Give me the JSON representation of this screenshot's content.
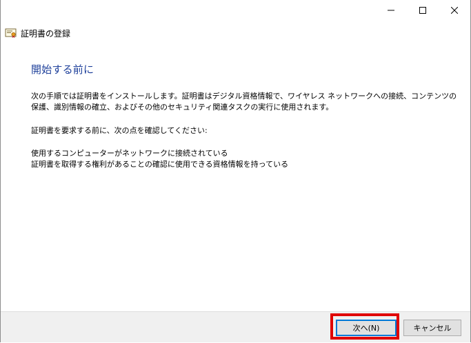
{
  "window": {
    "title": "証明書の登録"
  },
  "icons": {
    "minimize": "minimize-icon",
    "maximize": "maximize-icon",
    "close": "close-icon",
    "app": "certificate-icon"
  },
  "page": {
    "heading": "開始する前に",
    "paragraph1": "次の手順では証明書をインストールします。証明書はデジタル資格情報で、ワイヤレス ネットワークへの接続、コンテンツの保護、識別情報の確立、およびその他のセキュリティ関連タスクの実行に使用されます。",
    "paragraph2": "証明書を要求する前に、次の点を確認してください:",
    "requirement1": "使用するコンピューターがネットワークに接続されている",
    "requirement2": "証明書を取得する権利があることの確認に使用できる資格情報を持っている"
  },
  "buttons": {
    "next": "次へ(N)",
    "cancel": "キャンセル"
  },
  "colors": {
    "heading": "#1d3f9a",
    "highlight": "#e00000",
    "focus": "#0078d7"
  }
}
